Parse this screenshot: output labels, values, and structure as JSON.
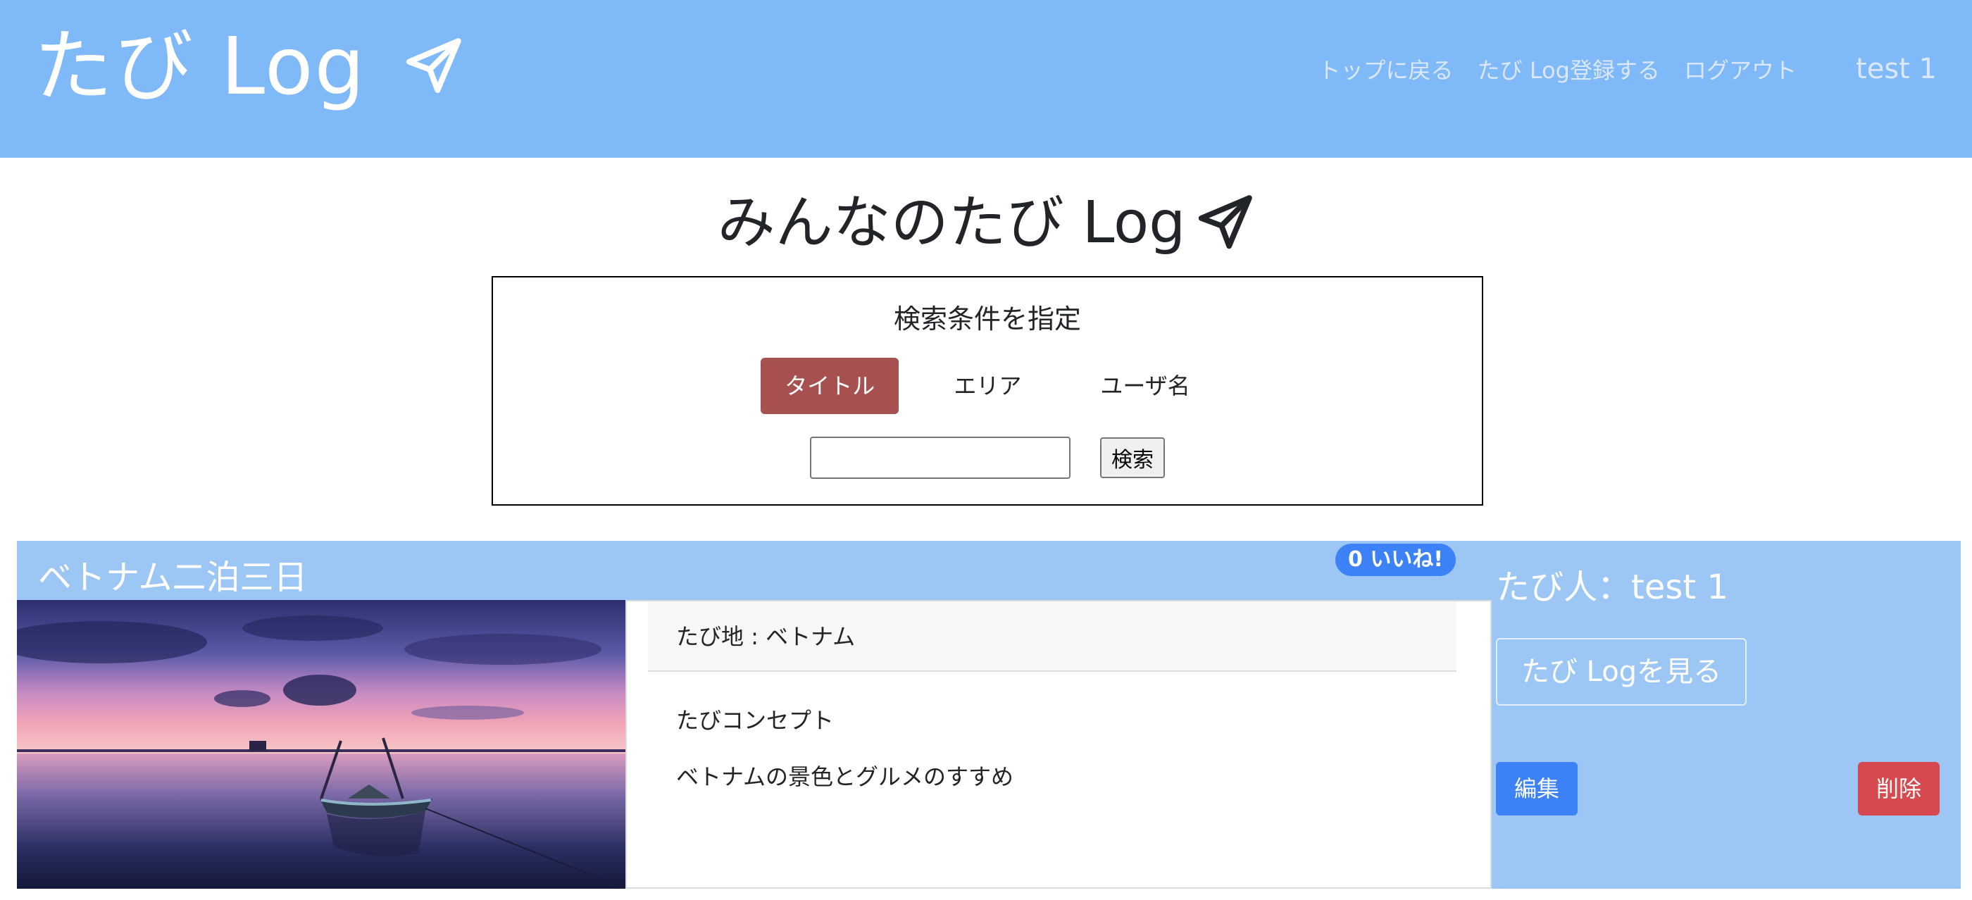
{
  "header": {
    "brand": "たび Log",
    "brand_icon": "paper-plane-icon",
    "nav": [
      "トップに戻る",
      "たび Log登録する",
      "ログアウト"
    ],
    "user": "test 1"
  },
  "page_title": "みんなのたび Log",
  "search": {
    "heading": "検索条件を指定",
    "tabs": [
      {
        "label": "タイトル",
        "active": true
      },
      {
        "label": "エリア",
        "active": false
      },
      {
        "label": "ユーザ名",
        "active": false
      }
    ],
    "input_value": "",
    "button_label": "検索"
  },
  "post": {
    "title": "ベトナム二泊三日",
    "likes": "0 いいね!",
    "destination": "たび地 : ベトナム",
    "concept_label": "たびコンセプト",
    "concept": "ベトナムの景色とグルメのすすめ",
    "traveler": "たび人：test 1",
    "view_button": "たび Logを見る",
    "edit_button": "編集",
    "delete_button": "削除"
  },
  "colors": {
    "header_bg": "#80b9f8",
    "card_bg": "#9cc7f5",
    "active_tab": "#a65150",
    "primary": "#3c82f6",
    "danger": "#d64a4f"
  }
}
